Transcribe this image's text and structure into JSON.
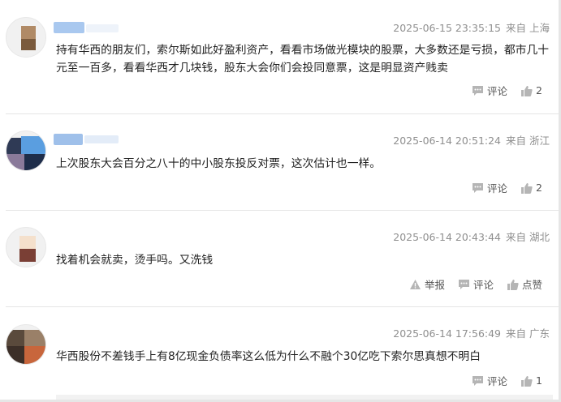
{
  "comments": [
    {
      "timestamp": "2025-06-15 23:35:15",
      "source": "来自 上海",
      "text": "持有华西的朋友们，索尔斯如此好盈利资产，看看市场做光模块的股票，大多数还是亏损，都市几十元至一百多，看看华西才几块钱，股东大会你们会投同意票，这是明显资产贱卖",
      "actions": {
        "comment_label": "评论",
        "like_count": "2"
      }
    },
    {
      "timestamp": "2025-06-14 20:51:24",
      "source": "来自 浙江",
      "text": "上次股东大会百分之八十的中小股东投反对票，这次估计也一样。",
      "actions": {
        "comment_label": "评论",
        "like_count": "2"
      }
    },
    {
      "timestamp": "2025-06-14 20:43:44",
      "source": "来自 湖北",
      "text": "找着机会就卖，烫手吗。又洗钱",
      "actions": {
        "report_label": "举报",
        "comment_label": "评论",
        "like_label": "点赞"
      }
    },
    {
      "timestamp": "2025-06-14 17:56:49",
      "source": "来自 广东",
      "text": "华西股份不差钱手上有8亿现金负债率这么低为什么不融个30亿吃下索尔思真想不明白",
      "actions": {
        "comment_label": "评论",
        "like_count": "1"
      }
    }
  ],
  "icons": {
    "comment": "comment-icon",
    "like": "thumbs-up-icon",
    "report": "warning-icon"
  },
  "colors": {
    "text": "#222222",
    "meta": "#8f8f8f",
    "action": "#555555",
    "divider": "#e5e5e5"
  }
}
